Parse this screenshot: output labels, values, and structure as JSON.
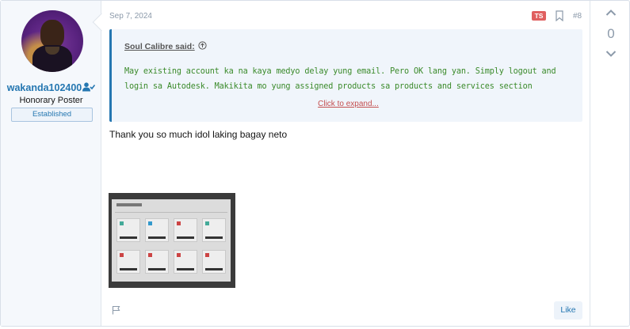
{
  "user": {
    "name": "wakanda102400",
    "title": "Honorary Poster",
    "badge": "Established"
  },
  "post": {
    "date": "Sep 7, 2024",
    "ts_badge": "TS",
    "number": "#8",
    "quote": {
      "author": "Soul Calibre said:",
      "text": "May existing account ka na kaya medyo delay yung email. Pero OK lang yan. Simply logout and login sa Autodesk. Makikita mo yung assigned products sa products and services section",
      "expand": "Click to expand..."
    },
    "body": "Thank you so much idol laking bagay neto",
    "like_label": "Like"
  },
  "vote": {
    "score": "0"
  },
  "colors": {
    "accent": "#2577b1",
    "quote_text": "#3a8a2a",
    "ts_badge": "#e06060"
  },
  "icons": [
    "verified-user-icon",
    "arrow-up-circle-icon",
    "bookmark-icon",
    "flag-icon",
    "chevron-up-icon",
    "chevron-down-icon"
  ]
}
